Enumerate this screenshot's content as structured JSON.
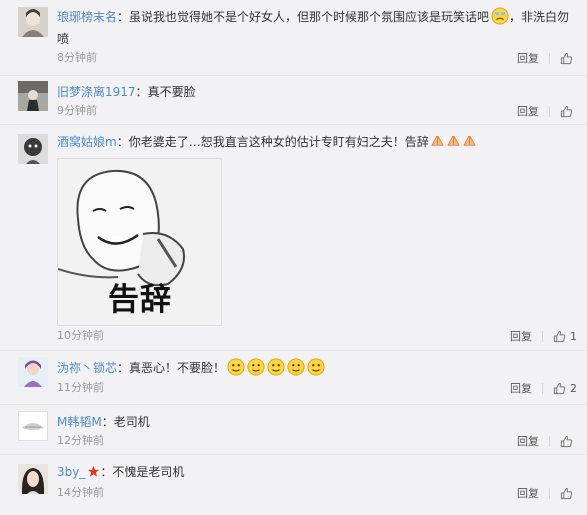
{
  "comments": [
    {
      "user": "琅琊榜末名",
      "text": "虽说我也觉得她不是个好女人，但那个时候那个氛围应该是玩笑话吧",
      "text_after_emoji": "，非洗白勿",
      "text_cont": "喷",
      "time": "8分钟前",
      "reply": "回复",
      "likes": ""
    },
    {
      "user": "旧梦涤离1917",
      "text": "真不要脸",
      "time": "9分钟前",
      "reply": "回复",
      "likes": ""
    },
    {
      "user": "酒窝姑娘m",
      "text": "你老婆走了…恕我直言这种女的估计专盯有妇之夫！告辞",
      "meme_caption": "告辞",
      "time": "10分钟前",
      "reply": "回复",
      "likes": "1"
    },
    {
      "user": "沩祢丶锁芯",
      "text": "真恶心！不要脸！",
      "time": "11分钟前",
      "reply": "回复",
      "likes": "2"
    },
    {
      "user": "M韩韬M",
      "text": "老司机",
      "time": "12分钟前",
      "reply": "回复",
      "likes": ""
    },
    {
      "user": "3by_",
      "text": "不愧是老司机",
      "time": "14分钟前",
      "reply": "回复",
      "likes": ""
    }
  ],
  "colors": {
    "username": "#4e8bc7",
    "time": "#999999",
    "background": "#f2f2f5"
  },
  "icons": {
    "like": "thumbs-up-icon",
    "emoji": "face-emoji-icon",
    "badge": "red-star-badge-icon"
  }
}
